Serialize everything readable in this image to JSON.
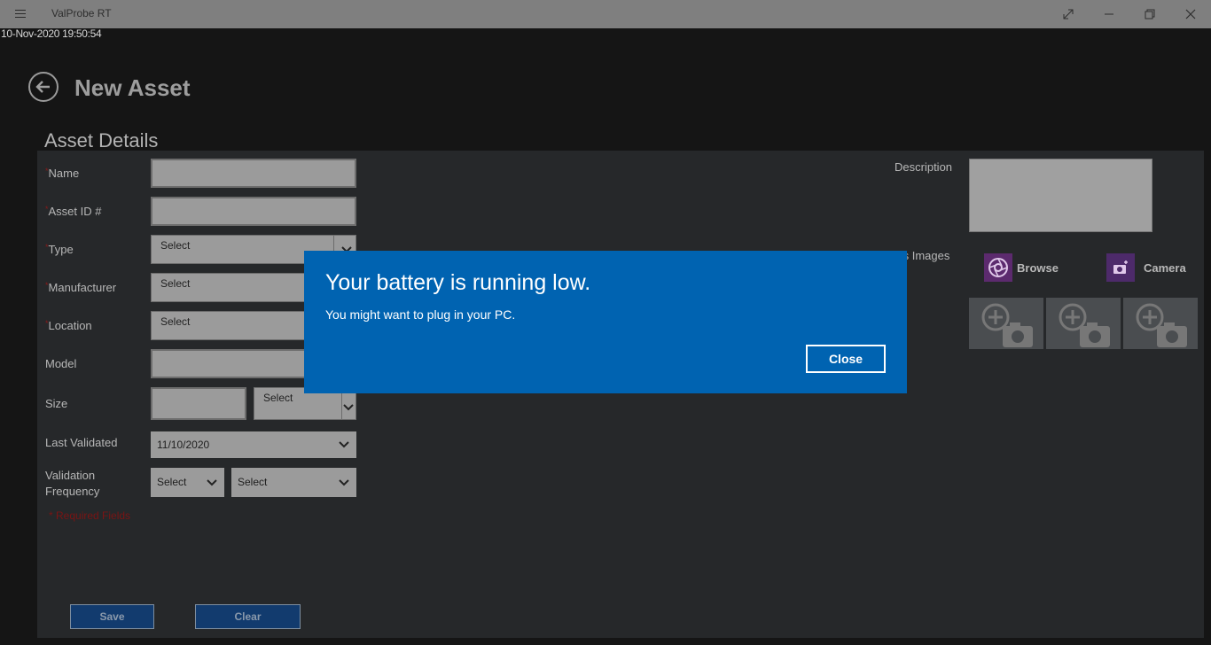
{
  "window": {
    "title": "ValProbe RT"
  },
  "timestamp": "10-Nov-2020 19:50:54",
  "page": {
    "title": "New Asset",
    "section": "Asset Details"
  },
  "form": {
    "required_mark": "*",
    "name_label": "Name",
    "asset_id_label": "Asset ID #",
    "type_label": "Type",
    "type_value": "Select",
    "manufacturer_label": "Manufacturer",
    "manufacturer_value": "Select",
    "location_label": "Location",
    "location_value": "Select",
    "model_label": "Model",
    "size_label": "Size",
    "size_unit_value": "Select",
    "last_validated_label": "Last Validated",
    "last_validated_value": "11/10/2020",
    "validation_frequency_label": "Validation\nFrequency",
    "frequency_number_value": "Select",
    "frequency_unit_value": "Select",
    "required_note": "* Required Fields",
    "save_label": "Save",
    "clear_label": "Clear"
  },
  "right": {
    "description_label": "Description",
    "images_label": "ts Images",
    "browse_label": "Browse",
    "camera_label": "Camera"
  },
  "toast": {
    "title": "Your battery is running low.",
    "body": "You might want to plug in your PC.",
    "close_label": "Close"
  },
  "colors": {
    "toast_bg": "#0063b1",
    "button_bg": "#123b6e",
    "required": "#8b1a1a"
  }
}
